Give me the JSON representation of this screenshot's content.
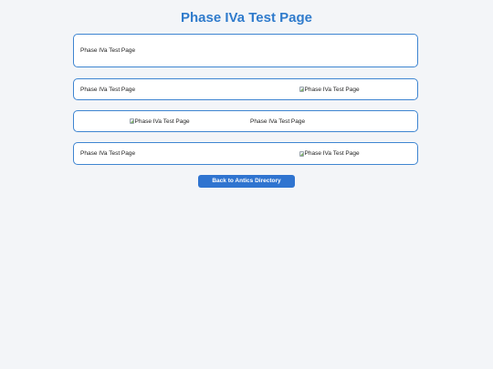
{
  "page": {
    "title": "Phase IVa Test Page"
  },
  "cards": [
    {
      "text": "Phase IVa Test Page"
    },
    {
      "text": "Phase IVa Test Page",
      "image_alt": "Phase IVa Test Page"
    },
    {
      "image_alt": "Phase IVa Test Page",
      "text": "Phase IVa Test Page"
    },
    {
      "text": "Phase IVa Test Page",
      "image_alt": "Phase IVa Test Page"
    }
  ],
  "back_button": {
    "label": "Back to Antics Directory"
  },
  "colors": {
    "accent": "#2f7bcc",
    "button": "#2f74d0",
    "card_border": "#3e85d1",
    "background": "#f3f5f8"
  },
  "icons": {
    "broken_image": "broken-image-icon"
  }
}
